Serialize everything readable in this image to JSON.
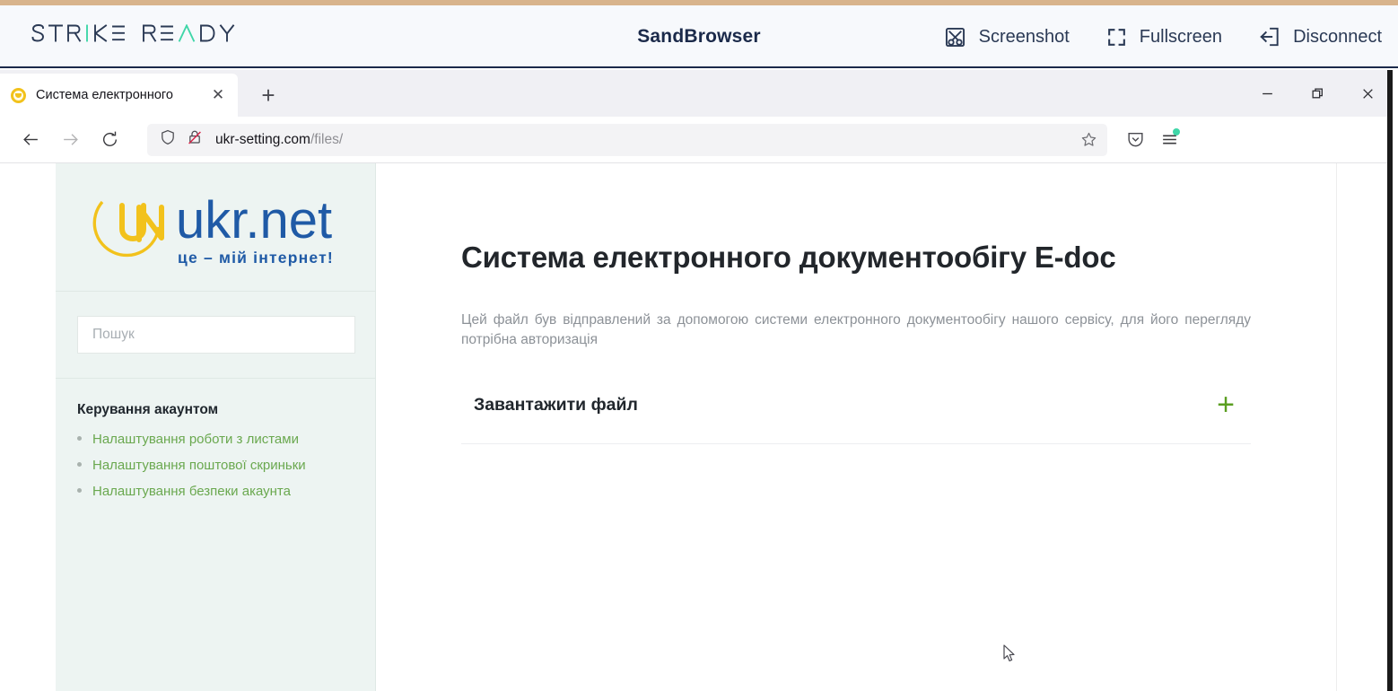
{
  "sandbrowser": {
    "brand": "STRIKE READY",
    "title": "SandBrowser",
    "actions": [
      {
        "label": "Screenshot",
        "icon": "screenshot-crop-icon"
      },
      {
        "label": "Fullscreen",
        "icon": "fullscreen-corners-icon"
      },
      {
        "label": "Disconnect",
        "icon": "disconnect-exit-icon"
      }
    ]
  },
  "browser": {
    "tab": {
      "title": "Система електронного",
      "favicon": "ukrnet-favicon",
      "close_label": "✕"
    },
    "newtab_label": "+",
    "window_controls": {
      "minimize": "minimize-icon",
      "restore": "restore-icon",
      "close": "close-icon"
    },
    "nav": {
      "back": "back-arrow-icon",
      "forward": "forward-arrow-icon",
      "reload": "reload-icon"
    },
    "url": {
      "host": "ukr-setting.com",
      "path": "/files/",
      "shield_icon": "shield-icon",
      "lock_icon": "insecure-lock-icon",
      "star_icon": "bookmark-star-icon"
    },
    "toolbar": {
      "pocket": "pocket-shield-icon",
      "menu": "hamburger-menu-icon"
    }
  },
  "site": {
    "logo": {
      "name": "ukr.net",
      "wordmark": "ukr.net",
      "tagline": "це – мій інтернет!"
    },
    "search": {
      "placeholder": "Пошук",
      "value": ""
    },
    "sidebar": {
      "heading": "Керування акаунтом",
      "items": [
        {
          "label": "Налаштування роботи з листами"
        },
        {
          "label": "Налаштування поштової скриньки"
        },
        {
          "label": "Налаштування безпеки акаунта"
        }
      ]
    },
    "main": {
      "title": "Система електронного документообігу E-doc",
      "description": "Цей файл був відправлений за допомогою системи електронного документообігу нашого сервісу, для його перегляду потрібна авторизація",
      "upload_label": "Завантажити файл",
      "upload_plus": "+"
    }
  },
  "colors": {
    "brand_dark": "#1b2a4a",
    "brand_accent": "#3fd6a8",
    "sidebar_bg": "#edf4f2",
    "link_green": "#6aa84f",
    "plus_green": "#5a9e20",
    "ukrnet_blue": "#1f5aa6",
    "ukrnet_yellow": "#f2c21c",
    "top_strip": "#d8b48c"
  }
}
